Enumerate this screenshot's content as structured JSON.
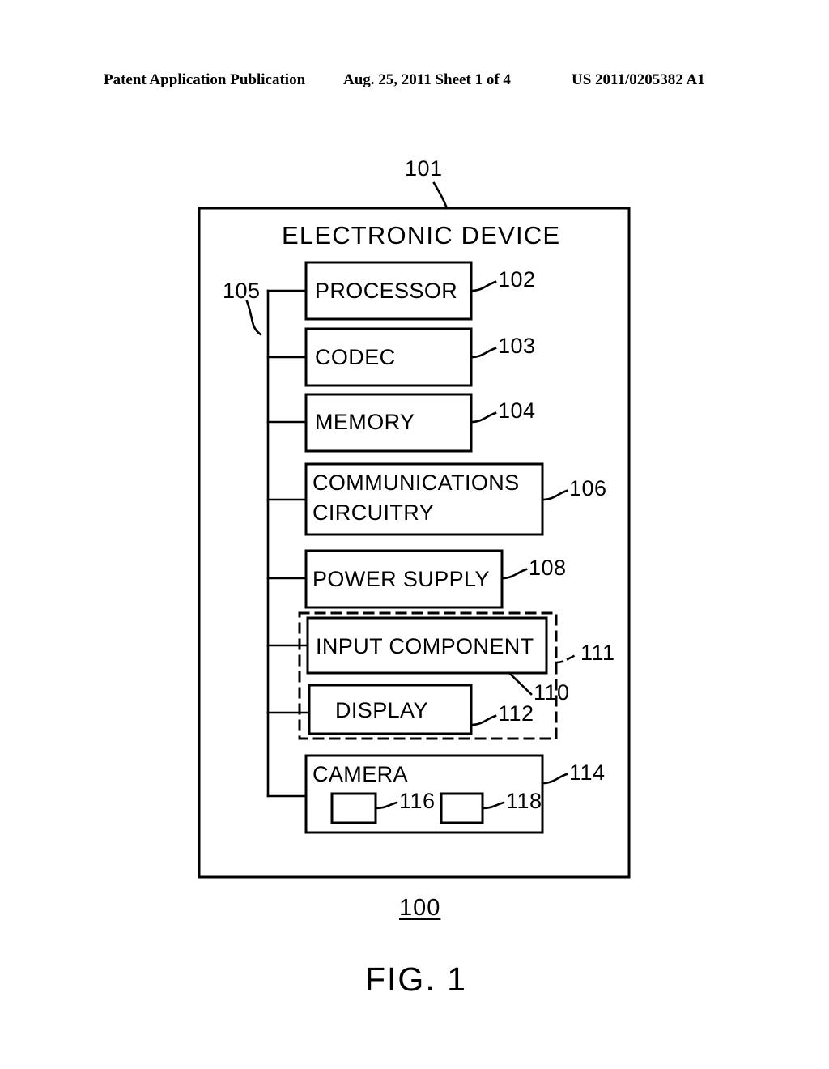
{
  "header": {
    "publication": "Patent Application Publication",
    "date_sheet": "Aug. 25, 2011  Sheet 1 of 4",
    "patent_number": "US 2011/0205382 A1"
  },
  "figure": {
    "caption": "FIG. 1",
    "figure_number": "100",
    "outer_ref": "101",
    "outer_title": "ELECTRONIC DEVICE",
    "bus_ref": "105",
    "blocks": [
      {
        "id": "processor",
        "label": "PROCESSOR",
        "ref": "102"
      },
      {
        "id": "codec",
        "label": "CODEC",
        "ref": "103"
      },
      {
        "id": "memory",
        "label": "MEMORY",
        "ref": "104"
      },
      {
        "id": "comms",
        "label": "COMMUNICATIONS CIRCUITRY",
        "ref": "106",
        "label_line1": "COMMUNICATIONS",
        "label_line2": "CIRCUITRY"
      },
      {
        "id": "power",
        "label": "POWER SUPPLY",
        "ref": "108"
      },
      {
        "id": "input",
        "label": "INPUT COMPONENT",
        "ref": "110"
      },
      {
        "id": "display",
        "label": "DISPLAY",
        "ref": "112"
      },
      {
        "id": "camera",
        "label": "CAMERA",
        "ref": "114"
      }
    ],
    "group_dashed_ref": "111",
    "camera_subparts": [
      {
        "id": "camera-sub-1",
        "ref": "116"
      },
      {
        "id": "camera-sub-2",
        "ref": "118"
      }
    ]
  },
  "style": {
    "ink": "#000000",
    "paper": "#ffffff"
  }
}
